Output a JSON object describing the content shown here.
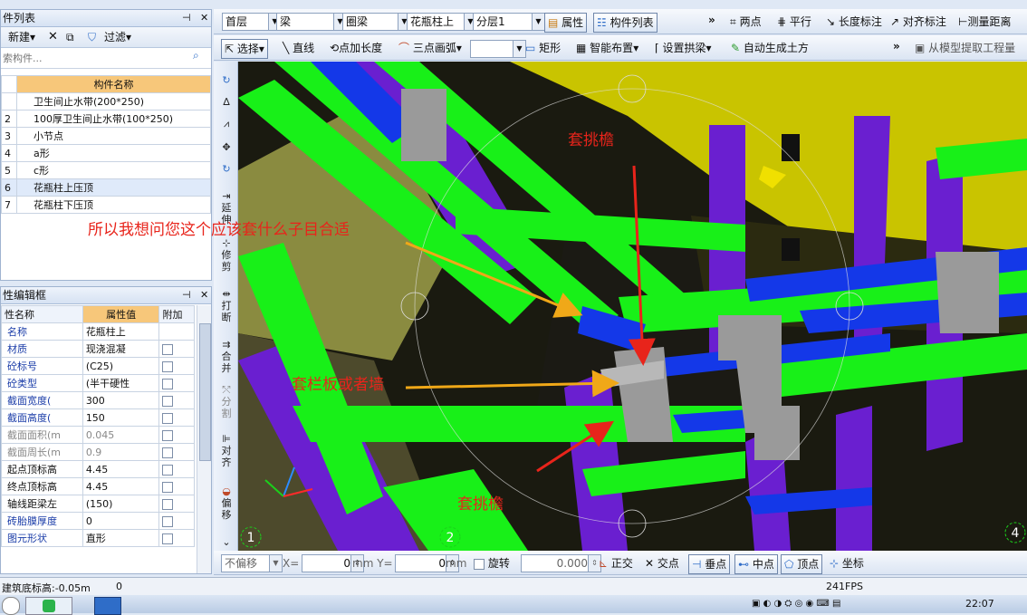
{
  "component_list": {
    "title": "件列表",
    "new_label": "新建",
    "filter_label": "过滤",
    "search_placeholder": "索构件...",
    "column_header": "构件名称",
    "rows": [
      {
        "num": "",
        "name": "卫生间止水带(200*250)"
      },
      {
        "num": "2",
        "name": "100厚卫生间止水带(100*250)"
      },
      {
        "num": "3",
        "name": "小节点"
      },
      {
        "num": "4",
        "name": "a形"
      },
      {
        "num": "5",
        "name": "c形"
      },
      {
        "num": "6",
        "name": "花瓶柱上压顶"
      },
      {
        "num": "7",
        "name": "花瓶柱下压顶"
      }
    ]
  },
  "property_editor": {
    "title": "性编辑框",
    "headers": [
      "性名称",
      "属性值",
      "附加"
    ],
    "rows": [
      {
        "name": "名称",
        "value": "花瓶柱上",
        "blue": true,
        "check": false
      },
      {
        "name": "材质",
        "value": "现浇混凝",
        "blue": true,
        "check": true
      },
      {
        "name": "砼标号",
        "value": "(C25)",
        "blue": true,
        "check": true
      },
      {
        "name": "砼类型",
        "value": "(半干硬性",
        "blue": true,
        "check": true
      },
      {
        "name": "截面宽度(",
        "value": "300",
        "blue": true,
        "check": true
      },
      {
        "name": "截面高度(",
        "value": "150",
        "blue": true,
        "check": true
      },
      {
        "name": "截面面积(m",
        "value": "0.045",
        "gray": true,
        "check": true
      },
      {
        "name": "截面周长(m",
        "value": "0.9",
        "gray": true,
        "check": true
      },
      {
        "name": "起点顶标高",
        "value": "4.45",
        "check": true
      },
      {
        "name": "终点顶标高",
        "value": "4.45",
        "check": true
      },
      {
        "name": "轴线距梁左",
        "value": "(150)",
        "check": true
      },
      {
        "name": "砖胎膜厚度",
        "value": "0",
        "blue": true,
        "check": true
      },
      {
        "name": "图元形状",
        "value": "直形",
        "blue": true,
        "check": true
      }
    ]
  },
  "toolbar1": {
    "floor": "首层",
    "type": "梁",
    "subtype": "圈梁",
    "component": "花瓶柱上",
    "layer": "分层1",
    "properties_btn": "属性",
    "component_list_btn": "构件列表",
    "two_points": "两点",
    "parallel": "平行",
    "length_dim": "长度标注",
    "align_dim": "对齐标注",
    "measure_dist": "测量距离"
  },
  "toolbar2": {
    "select": "选择",
    "line": "直线",
    "point_length": "点加长度",
    "three_point_arc": "三点画弧",
    "rectangle": "矩形",
    "smart_layout": "智能布置",
    "set_arch_beam": "设置拱梁",
    "auto_earth": "自动生成土方",
    "extract_from_model": "从模型提取工程量"
  },
  "vertical_tools": [
    "延伸",
    "修剪",
    "打断",
    "合并",
    "分割",
    "对齐",
    "偏移"
  ],
  "annotations": {
    "top": "套挑檐",
    "question": "所以我想问您这个应该套什么子目合适",
    "middle": "套栏板或者墙",
    "bottom": "套挑檐"
  },
  "axis_labels": [
    "1",
    "2",
    "4"
  ],
  "snap_bar": {
    "no_offset": "不偏移",
    "x_label": "X=",
    "x_value": "0",
    "y_label": "mm Y=",
    "y_value": "0",
    "mm": "mm",
    "rotate": "旋转",
    "rotate_value": "0.000",
    "orthogonal": "正交",
    "intersection": "交点",
    "perpendicular": "垂点",
    "midpoint": "中点",
    "vertex": "顶点",
    "coordinate": "坐标"
  },
  "status_bar": {
    "elevation": "建筑底标高:-0.05m",
    "value": "0",
    "fps": "241FPS"
  },
  "taskbar": {
    "clock": "22:07"
  },
  "colors": {
    "accent_orange": "#f7c77a",
    "scene_yellow": "#c9c400",
    "beam_green": "#18f018",
    "beam_purple": "#6a1fd0",
    "beam_blue": "#1438e8",
    "annotation_red": "#e8241b"
  }
}
